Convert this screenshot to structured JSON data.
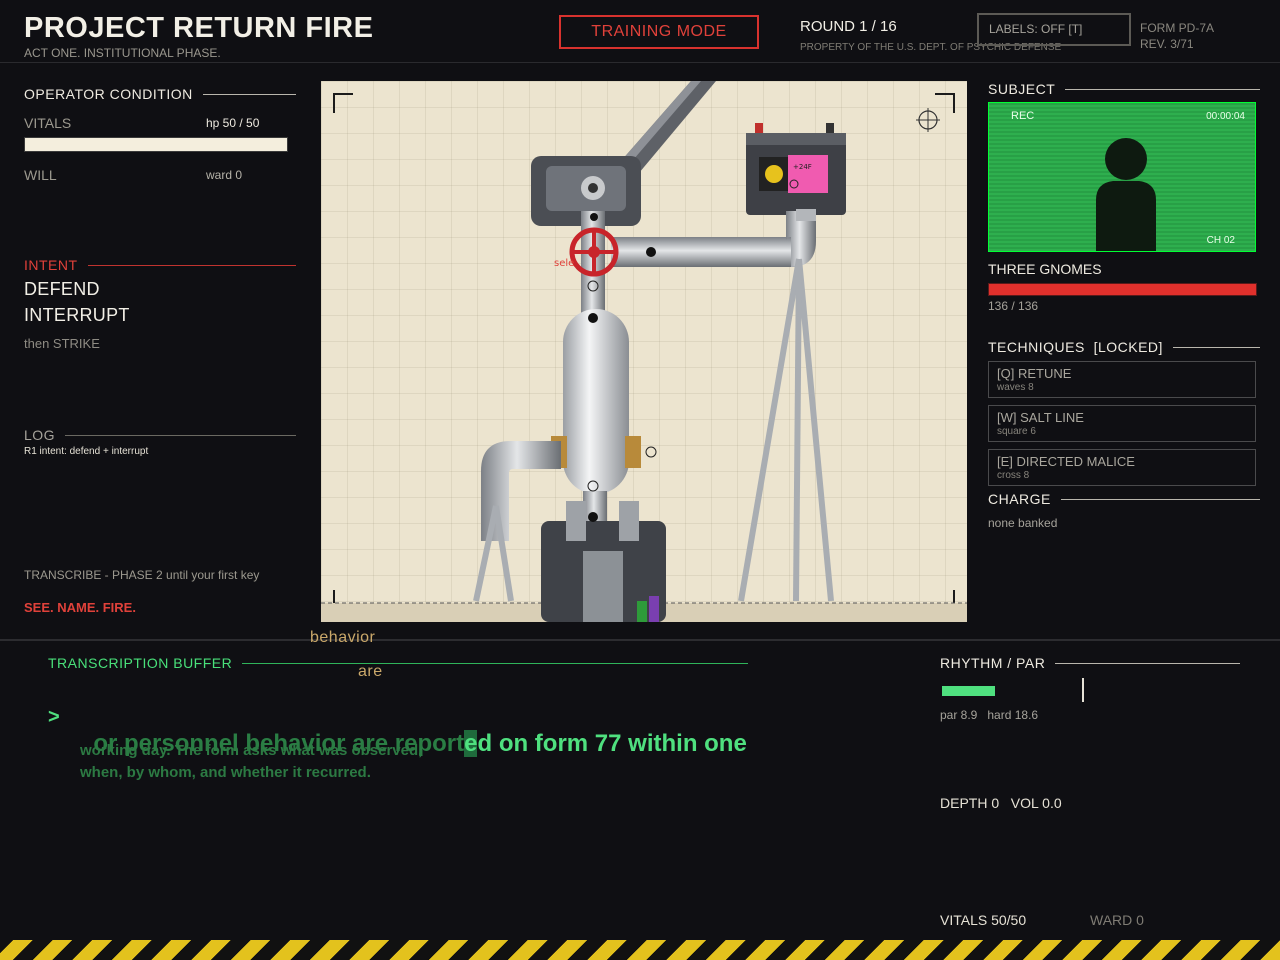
{
  "header": {
    "title": "PROJECT RETURN FIRE",
    "subtitle": "ACT ONE. INSTITUTIONAL PHASE.",
    "mode_button": "TRAINING MODE",
    "round": "ROUND 1 / 16",
    "property": "PROPERTY OF THE U.S. DEPT. OF PSYCHIC DEFENSE",
    "labels_toggle": "LABELS: OFF [T]",
    "form_id": "FORM PD-7A",
    "form_rev": "REV. 3/71"
  },
  "operator": {
    "heading": "OPERATOR CONDITION",
    "vitals_label": "VITALS",
    "hp_text": "hp 50 / 50",
    "hp_fraction": 1.0,
    "will_label": "WILL",
    "ward_text": "ward 0"
  },
  "intent": {
    "heading": "INTENT",
    "items": [
      "DEFEND",
      "INTERRUPT"
    ],
    "then": "then STRIKE"
  },
  "log": {
    "heading": "LOG",
    "entries": [
      "R1 intent: defend + interrupt"
    ]
  },
  "hints": {
    "transcribe": "TRANSCRIBE - PHASE 2 until your first key",
    "motto": "SEE. NAME. FIRE."
  },
  "stage": {
    "marker_label": "sele",
    "battery_label": "+24F"
  },
  "subject": {
    "heading": "SUBJECT",
    "rec": "REC",
    "timer": "00:00:04",
    "channel": "CH 02",
    "enemy_name": "THREE GNOMES",
    "enemy_hp": "136 / 136",
    "enemy_fraction": 1.0
  },
  "techniques": {
    "heading": "TECHNIQUES  [LOCKED]",
    "items": [
      {
        "name": "[Q] RETUNE",
        "sub": "waves 8"
      },
      {
        "name": "[W] SALT LINE",
        "sub": "square 6"
      },
      {
        "name": "[E] DIRECTED MALICE",
        "sub": "cross 8"
      }
    ]
  },
  "charge": {
    "heading": "CHARGE",
    "status": "none banked"
  },
  "buffer": {
    "heading": "TRANSCRIPTION BUFFER",
    "prompt": ">",
    "typed": "or personnel behavior are report",
    "cursor": "e",
    "untyped": "d on form 77 within one",
    "next_line_1": "working day. The form asks what was observed,",
    "next_line_2": "when, by whom, and whether it recurred.",
    "float_words": [
      "behavior",
      "are"
    ]
  },
  "rhythm": {
    "heading": "RHYTHM / PAR",
    "par": "par 8.9",
    "hard": "hard 18.6",
    "depth": "DEPTH 0",
    "vol": "VOL 0.0"
  },
  "footer": {
    "vitals": "VITALS 50/50",
    "ward": "WARD 0"
  },
  "colors": {
    "accent_red": "#e0413a",
    "buffer_green": "#4fe07f",
    "hazard_yellow": "#e3c21d"
  }
}
